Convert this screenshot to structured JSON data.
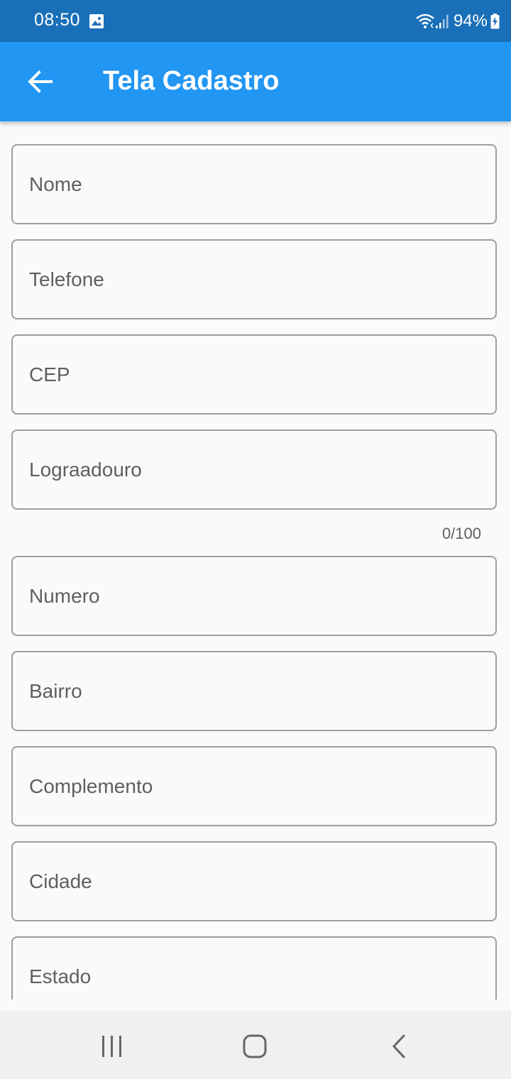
{
  "status_bar": {
    "time": "08:50",
    "battery": "94%",
    "icons": [
      "image-notification-icon",
      "wifi-icon",
      "signal-icon",
      "battery-charging-icon"
    ]
  },
  "app_bar": {
    "title": "Tela Cadastro",
    "back_icon": "arrow-back-icon",
    "background": "#2196f3"
  },
  "form": {
    "fields": [
      {
        "placeholder": "Nome",
        "value": ""
      },
      {
        "placeholder": "Telefone",
        "value": ""
      },
      {
        "placeholder": "CEP",
        "value": ""
      },
      {
        "placeholder": "Lograadouro",
        "value": "",
        "counter": "0/100"
      },
      {
        "placeholder": "Numero",
        "value": ""
      },
      {
        "placeholder": "Bairro",
        "value": ""
      },
      {
        "placeholder": "Complemento",
        "value": ""
      },
      {
        "placeholder": "Cidade",
        "value": ""
      },
      {
        "placeholder": "Estado",
        "value": ""
      }
    ]
  },
  "nav_bar": {
    "icons": [
      "recent-apps-icon",
      "home-icon",
      "back-icon"
    ]
  },
  "colors": {
    "status_bar": "#1a6fb9",
    "app_bar": "#2196f3",
    "field_border": "#9e9e9e",
    "text": "#5f5f5f"
  }
}
